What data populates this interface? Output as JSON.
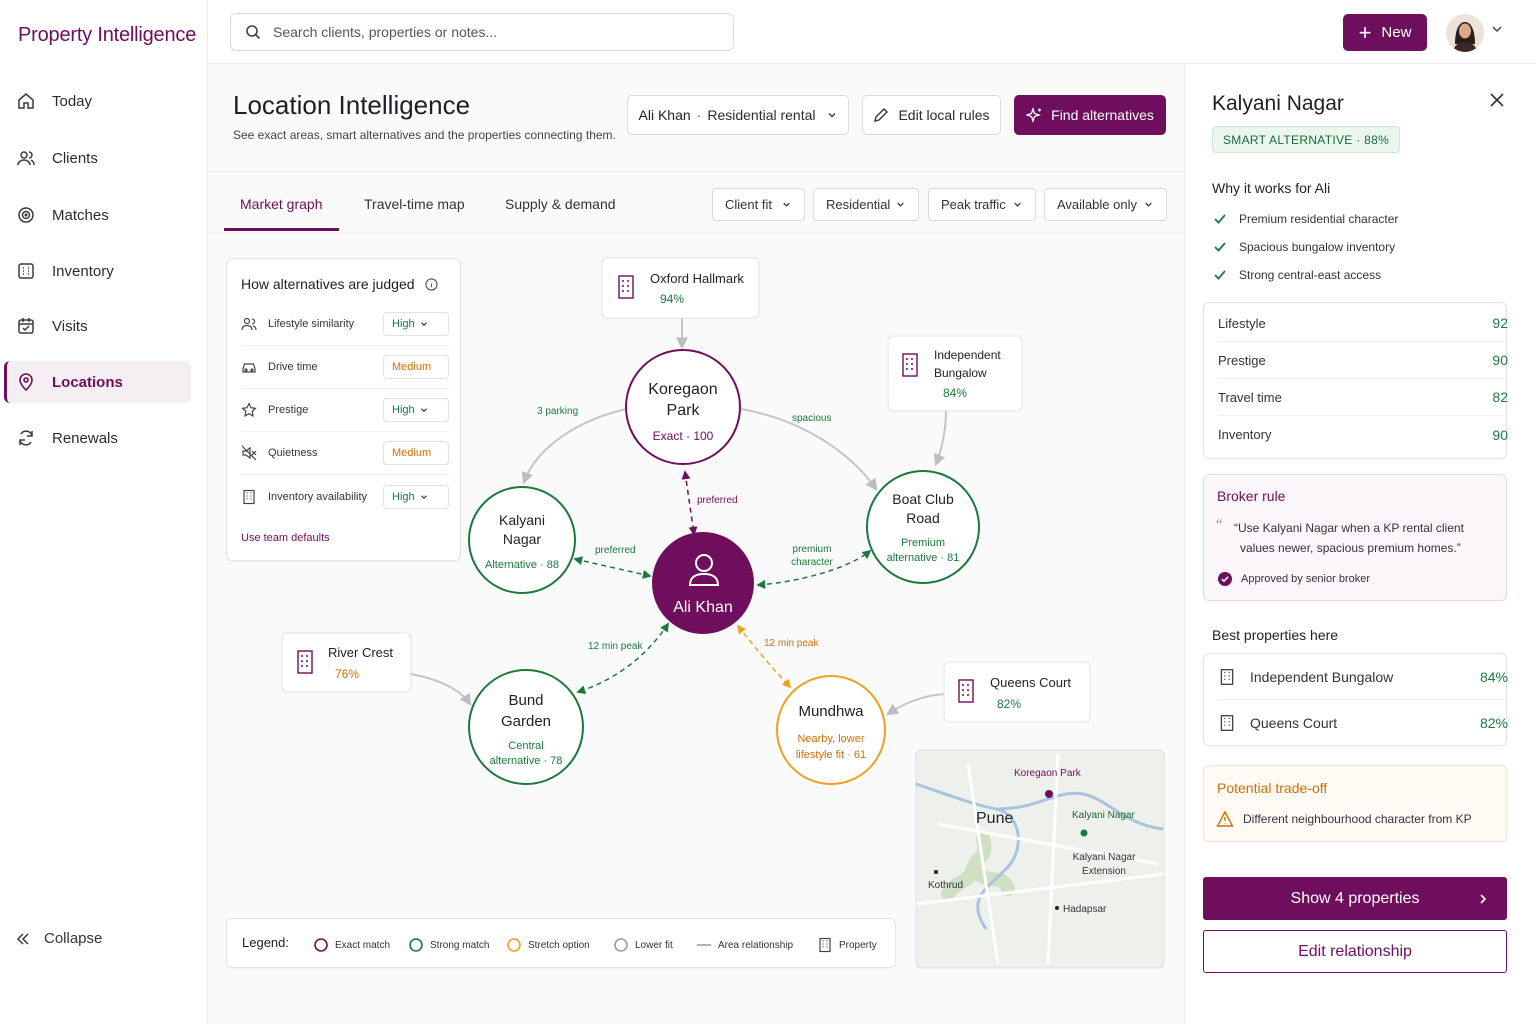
{
  "brand": "Property Intelligence",
  "nav": [
    {
      "label": "Today",
      "icon": "home-icon"
    },
    {
      "label": "Clients",
      "icon": "users-icon"
    },
    {
      "label": "Matches",
      "icon": "target-icon"
    },
    {
      "label": "Inventory",
      "icon": "inventory-icon"
    },
    {
      "label": "Visits",
      "icon": "calendar-check-icon"
    },
    {
      "label": "Locations",
      "icon": "map-pin-icon",
      "active": true
    },
    {
      "label": "Renewals",
      "icon": "refresh-icon"
    }
  ],
  "collapse_label": "Collapse",
  "search": {
    "placeholder": "Search clients, properties or notes..."
  },
  "new_label": "New",
  "page": {
    "title": "Location Intelligence",
    "subtitle": "See exact areas, smart alternatives and the properties connecting them.",
    "client": "Ali Khan",
    "client_type": "Residential rental",
    "edit_rules": "Edit local rules",
    "find_alt": "Find alternatives"
  },
  "tabs": [
    "Market graph",
    "Travel-time map",
    "Supply & demand"
  ],
  "filters": [
    "Client fit",
    "Residential",
    "Peak traffic",
    "Available only"
  ],
  "criteria": {
    "title": "How alternatives are judged",
    "rows": [
      {
        "label": "Lifestyle similarity",
        "value": "High",
        "tone": "g"
      },
      {
        "label": "Drive time",
        "value": "Medium",
        "tone": "o"
      },
      {
        "label": "Prestige",
        "value": "High",
        "tone": "g"
      },
      {
        "label": "Quietness",
        "value": "Medium",
        "tone": "o"
      },
      {
        "label": "Inventory availability",
        "value": "High",
        "tone": "g"
      }
    ],
    "defaults": "Use team defaults"
  },
  "graph": {
    "center": "Ali Khan",
    "kp": {
      "name1": "Koregaon",
      "name2": "Park",
      "sub": "Exact · 100"
    },
    "kn": {
      "name1": "Kalyani",
      "name2": "Nagar",
      "sub": "Alternative · 88"
    },
    "bcr": {
      "name1": "Boat Club",
      "name2": "Road",
      "sub1": "Premium",
      "sub2": "alternative · 81"
    },
    "bg": {
      "name1": "Bund",
      "name2": "Garden",
      "sub1": "Central",
      "sub2": "alternative · 78"
    },
    "mw": {
      "name": "Mundhwa",
      "sub1": "Nearby, lower",
      "sub2": "lifestyle fit · 61"
    },
    "props": {
      "oxford": {
        "name": "Oxford Hallmark",
        "pct": "94%"
      },
      "indep": {
        "name1": "Independent",
        "name2": "Bungalow",
        "pct": "84%"
      },
      "river": {
        "name": "River Crest",
        "pct": "76%"
      },
      "queens": {
        "name": "Queens Court",
        "pct": "82%"
      }
    },
    "edges": {
      "parking": "3 parking",
      "spacious": "spacious",
      "preferred_kp": "preferred",
      "preferred_kn": "preferred",
      "premium1": "premium",
      "premium2": "character",
      "peak_bg": "12 min peak",
      "peak_mw": "12 min peak"
    },
    "map": {
      "city": "Pune",
      "kp": "Koregaon Park",
      "kn": "Kalyani Nagar",
      "ext1": "Kalyani Nagar",
      "ext2": "Extension",
      "kothrud": "Kothrud",
      "hadapsar": "Hadapsar"
    }
  },
  "legend": {
    "title": "Legend:",
    "items": [
      "Exact match",
      "Strong match",
      "Stretch option",
      "Lower fit",
      "Area relationship",
      "Property"
    ]
  },
  "colors": {
    "exact": "#6e0e5c",
    "strong": "#1a7a3c",
    "stretch": "#f0a020",
    "lower": "#9a9aa0"
  },
  "panel": {
    "title": "Kalyani Nagar",
    "badge": "SMART ALTERNATIVE · 88%",
    "why_title": "Why it works for Ali",
    "why": [
      "Premium residential character",
      "Spacious bungalow inventory",
      "Strong central-east access"
    ],
    "scores": [
      {
        "label": "Lifestyle",
        "value": "92"
      },
      {
        "label": "Prestige",
        "value": "90"
      },
      {
        "label": "Travel time",
        "value": "82"
      },
      {
        "label": "Inventory",
        "value": "90"
      }
    ],
    "rule_title": "Broker rule",
    "rule_quote1": "“Use Kalyani Nagar when a KP rental client",
    "rule_quote2": "values newer, spacious premium homes.”",
    "rule_approved": "Approved by senior broker",
    "best_title": "Best properties here",
    "best": [
      {
        "name": "Independent Bungalow",
        "pct": "84%"
      },
      {
        "name": "Queens Court",
        "pct": "82%"
      }
    ],
    "tradeoff_title": "Potential trade-off",
    "tradeoff": "Different neighbourhood character from KP",
    "show_btn": "Show 4 properties",
    "edit_btn": "Edit relationship"
  }
}
